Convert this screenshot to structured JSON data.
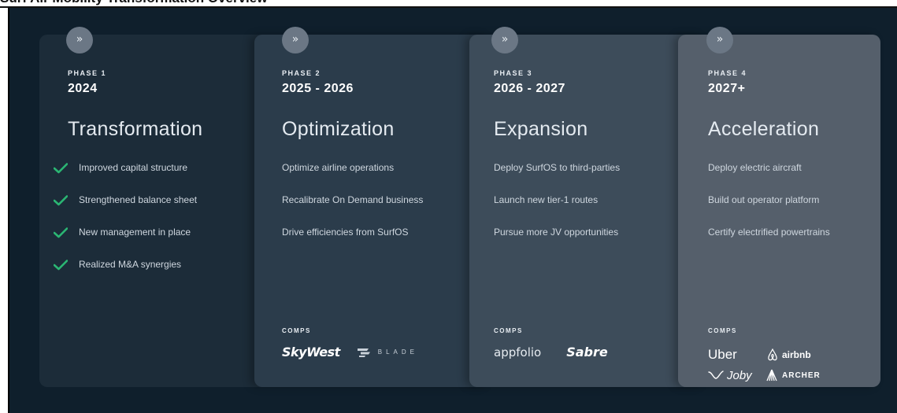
{
  "page": {
    "title": "Surf Air Mobility Transformation Overview"
  },
  "phases": [
    {
      "icon": "chevron-double-right-icon",
      "phase_label": "PHASE 1",
      "years": "2024",
      "heading": "Transformation",
      "items": [
        "Improved capital structure",
        "Strengthened balance sheet",
        "New management in place",
        "Realized M&A synergies"
      ],
      "item_icon": "checkmark-icon",
      "check_color": "#2bb673"
    },
    {
      "icon": "chevron-double-right-icon",
      "phase_label": "PHASE 2",
      "years": "2025 - 2026",
      "heading": "Optimization",
      "items": [
        "Optimize airline operations",
        "Recalibrate On Demand business",
        "Drive efficiencies from SurfOS"
      ],
      "comps_label": "COMPS",
      "comps": [
        "SkyWest",
        "BLADE"
      ]
    },
    {
      "icon": "chevron-double-right-icon",
      "phase_label": "PHASE 3",
      "years": "2026 - 2027",
      "heading": "Expansion",
      "items": [
        "Deploy SurfOS to third-parties",
        "Launch new tier-1 routes",
        "Pursue more JV opportunities"
      ],
      "comps_label": "COMPS",
      "comps": [
        "appfolio",
        "Sabre"
      ]
    },
    {
      "icon": "chevron-double-right-icon",
      "phase_label": "PHASE 4",
      "years": "2027+",
      "heading": "Acceleration",
      "items": [
        "Deploy electric aircraft",
        "Build out operator platform",
        "Certify electrified powertrains"
      ],
      "comps_label": "COMPS",
      "comps": [
        "Uber",
        "airbnb",
        "Joby",
        "ARCHER"
      ]
    }
  ],
  "colors": {
    "background": "#0f1f2c",
    "panel_1": "#1c2c39",
    "panel_2": "#2b3c4b",
    "panel_3": "#3d4c5a",
    "panel_4": "#555f6b",
    "accent_check": "#2bb673"
  }
}
